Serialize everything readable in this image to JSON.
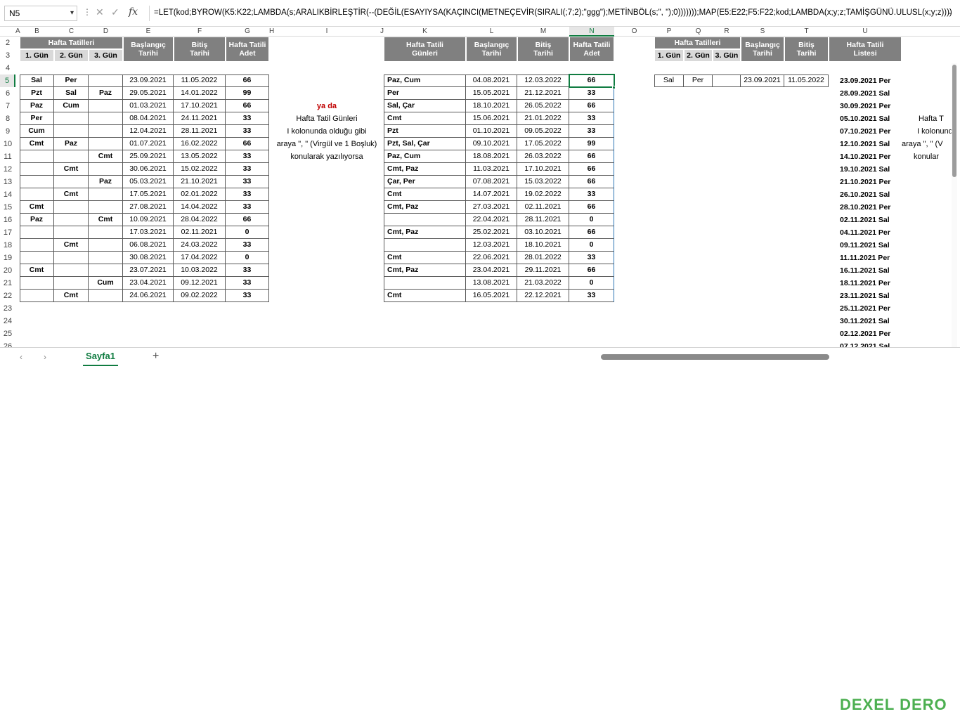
{
  "formula_bar": {
    "name_box": "N5",
    "formula": "=LET(kod;BYROW(K5:K22;LAMBDA(s;ARALIKBİRLEŞTİR(--(DEĞİL(ESAYIYSA(KAÇINCI(METNEÇEVİR(SIRALI(;7;2);\"ggg\");METİNBÖL(s;\", \");0)))))));MAP(E5:E22;F5:F22;kod;LAMBDA(x;y;z;TAMİŞGÜNÜ.ULUSL(x;y;z))))"
  },
  "columns": [
    "A",
    "B",
    "C",
    "D",
    "E",
    "F",
    "G",
    "H",
    "I",
    "J",
    "K",
    "L",
    "M",
    "N",
    "O",
    "P",
    "Q",
    "R",
    "S",
    "T",
    "U"
  ],
  "rows": [
    "2",
    "3",
    "4",
    "5",
    "6",
    "7",
    "8",
    "9",
    "10",
    "11",
    "12",
    "13",
    "14",
    "15",
    "16",
    "17",
    "18",
    "19",
    "20",
    "21",
    "22",
    "23",
    "24",
    "25",
    "26"
  ],
  "table1": {
    "title": "Hafta Tatilleri",
    "sub": [
      "1. Gün",
      "2. Gün",
      "3. Gün"
    ],
    "start_hdr": "Başlangıç\nTarihi",
    "end_hdr": "Bitiş\nTarihi",
    "count_hdr": "Hafta Tatili\nAdet",
    "rows": [
      [
        "Sal",
        "Per",
        "",
        "23.09.2021",
        "11.05.2022",
        "66"
      ],
      [
        "Pzt",
        "Sal",
        "Paz",
        "29.05.2021",
        "14.01.2022",
        "99"
      ],
      [
        "Paz",
        "Cum",
        "",
        "01.03.2021",
        "17.10.2021",
        "66"
      ],
      [
        "Per",
        "",
        "",
        "08.04.2021",
        "24.11.2021",
        "33"
      ],
      [
        "Cum",
        "",
        "",
        "12.04.2021",
        "28.11.2021",
        "33"
      ],
      [
        "Cmt",
        "Paz",
        "",
        "01.07.2021",
        "16.02.2022",
        "66"
      ],
      [
        "",
        "",
        "Cmt",
        "25.09.2021",
        "13.05.2022",
        "33"
      ],
      [
        "",
        "Cmt",
        "",
        "30.06.2021",
        "15.02.2022",
        "33"
      ],
      [
        "",
        "",
        "Paz",
        "05.03.2021",
        "21.10.2021",
        "33"
      ],
      [
        "",
        "Cmt",
        "",
        "17.05.2021",
        "02.01.2022",
        "33"
      ],
      [
        "Cmt",
        "",
        "",
        "27.08.2021",
        "14.04.2022",
        "33"
      ],
      [
        "Paz",
        "",
        "Cmt",
        "10.09.2021",
        "28.04.2022",
        "66"
      ],
      [
        "",
        "",
        "",
        "17.03.2021",
        "02.11.2021",
        "0"
      ],
      [
        "",
        "Cmt",
        "",
        "06.08.2021",
        "24.03.2022",
        "33"
      ],
      [
        "",
        "",
        "",
        "30.08.2021",
        "17.04.2022",
        "0"
      ],
      [
        "Cmt",
        "",
        "",
        "23.07.2021",
        "10.03.2022",
        "33"
      ],
      [
        "",
        "",
        "Cum",
        "23.04.2021",
        "09.12.2021",
        "33"
      ],
      [
        "",
        "Cmt",
        "",
        "24.06.2021",
        "09.02.2022",
        "33"
      ]
    ]
  },
  "note": {
    "line1": "ya da",
    "line2": "Hafta Tatil Günleri",
    "line3": "I kolonunda olduğu gibi",
    "line4": "araya \", \" (Virgül ve 1 Boşluk)",
    "line5": "konularak yazılıyorsa"
  },
  "table2": {
    "days_hdr": "Hafta Tatili\nGünleri",
    "start_hdr": "Başlangıç\nTarihi",
    "end_hdr": "Bitiş\nTarihi",
    "count_hdr": "Hafta Tatili\nAdet",
    "rows": [
      [
        "Paz, Cum",
        "04.08.2021",
        "12.03.2022",
        "66"
      ],
      [
        "Per",
        "15.05.2021",
        "21.12.2021",
        "33"
      ],
      [
        "Sal, Çar",
        "18.10.2021",
        "26.05.2022",
        "66"
      ],
      [
        "Cmt",
        "15.06.2021",
        "21.01.2022",
        "33"
      ],
      [
        "Pzt",
        "01.10.2021",
        "09.05.2022",
        "33"
      ],
      [
        "Pzt, Sal, Çar",
        "09.10.2021",
        "17.05.2022",
        "99"
      ],
      [
        "Paz, Cum",
        "18.08.2021",
        "26.03.2022",
        "66"
      ],
      [
        "Cmt, Paz",
        "11.03.2021",
        "17.10.2021",
        "66"
      ],
      [
        "Çar, Per",
        "07.08.2021",
        "15.03.2022",
        "66"
      ],
      [
        "Cmt",
        "14.07.2021",
        "19.02.2022",
        "33"
      ],
      [
        "Cmt, Paz",
        "27.03.2021",
        "02.11.2021",
        "66"
      ],
      [
        "",
        "22.04.2021",
        "28.11.2021",
        "0"
      ],
      [
        "Cmt, Paz",
        "25.02.2021",
        "03.10.2021",
        "66"
      ],
      [
        "",
        "12.03.2021",
        "18.10.2021",
        "0"
      ],
      [
        "Cmt",
        "22.06.2021",
        "28.01.2022",
        "33"
      ],
      [
        "Cmt, Paz",
        "23.04.2021",
        "29.11.2021",
        "66"
      ],
      [
        "",
        "13.08.2021",
        "21.03.2022",
        "0"
      ],
      [
        "Cmt",
        "16.05.2021",
        "22.12.2021",
        "33"
      ]
    ]
  },
  "table3": {
    "title": "Hafta Tatilleri",
    "sub": [
      "1. Gün",
      "2. Gün",
      "3. Gün"
    ],
    "start_hdr": "Başlangıç\nTarihi",
    "end_hdr": "Bitiş\nTarihi",
    "list_hdr": "Hafta Tatili\nListesi",
    "row": [
      "Sal",
      "Per",
      "",
      "23.09.2021",
      "11.05.2022"
    ]
  },
  "list": [
    "23.09.2021 Per",
    "28.09.2021 Sal",
    "30.09.2021 Per",
    "05.10.2021 Sal",
    "07.10.2021 Per",
    "12.10.2021 Sal",
    "14.10.2021 Per",
    "19.10.2021 Sal",
    "21.10.2021 Per",
    "26.10.2021 Sal",
    "28.10.2021 Per",
    "02.11.2021 Sal",
    "04.11.2021 Per",
    "09.11.2021 Sal",
    "11.11.2021 Per",
    "16.11.2021 Sal",
    "18.11.2021 Per",
    "23.11.2021 Sal",
    "25.11.2021 Per",
    "30.11.2021 Sal",
    "02.12.2021 Per",
    "07.12.2021 Sal"
  ],
  "right_note": {
    "line1": "Hafta T",
    "line2": "I kolonund",
    "line3": "araya \", \" (V",
    "line4": "konular"
  },
  "tabs": {
    "sheet": "Sayfa1",
    "add": "+",
    "prev": "‹",
    "next": "›"
  },
  "logo": "DEXEL DERO"
}
